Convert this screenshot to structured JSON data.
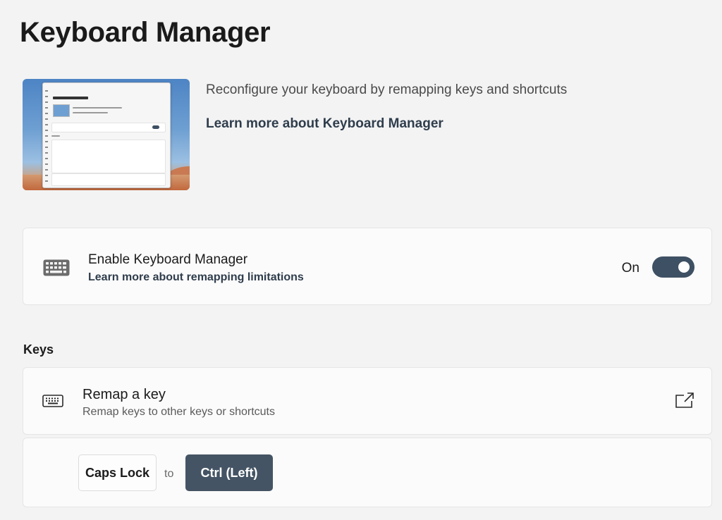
{
  "page": {
    "title": "Keyboard Manager"
  },
  "hero": {
    "description": "Reconfigure your keyboard by remapping keys and shortcuts",
    "learn_more": "Learn more about Keyboard Manager"
  },
  "enable": {
    "title": "Enable Keyboard Manager",
    "link": "Learn more about remapping limitations",
    "toggle_state": "On",
    "toggle_on": true,
    "icon": "keyboard-icon"
  },
  "keys_section": {
    "header": "Keys",
    "remap": {
      "title": "Remap a key",
      "description": "Remap keys to other keys or shortcuts",
      "icon": "keyboard-icon",
      "action_icon": "open-external-icon"
    },
    "mappings": [
      {
        "from": "Caps Lock",
        "to_label": "to",
        "to": "Ctrl (Left)"
      }
    ]
  },
  "colors": {
    "accent": "#3e5063",
    "background": "#f3f3f3",
    "card": "#fbfbfb"
  }
}
